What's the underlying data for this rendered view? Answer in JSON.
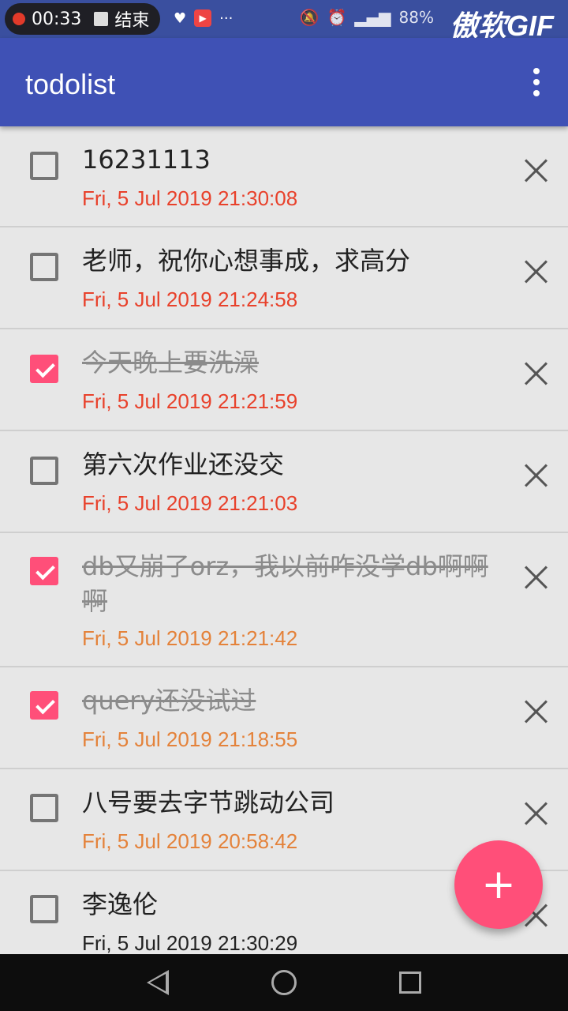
{
  "status": {
    "time": "00:33",
    "end_label": "结束",
    "battery": "88%",
    "watermark": "傲软GIF"
  },
  "appbar": {
    "title": "todolist"
  },
  "colors": {
    "appbar": "#3f51b5",
    "accent": "#ff4f79",
    "date_red": "#e8412b",
    "date_orange": "#e4823a",
    "date_black": "#222222"
  },
  "todos": [
    {
      "text": "16231113",
      "date": "Fri, 5 Jul 2019 21:30:08",
      "done": false,
      "date_color": "red"
    },
    {
      "text": "老师，祝你心想事成，求高分",
      "date": "Fri, 5 Jul 2019 21:24:58",
      "done": false,
      "date_color": "red"
    },
    {
      "text": "今天晚上要洗澡",
      "date": "Fri, 5 Jul 2019 21:21:59",
      "done": true,
      "date_color": "red"
    },
    {
      "text": "第六次作业还没交",
      "date": "Fri, 5 Jul 2019 21:21:03",
      "done": false,
      "date_color": "red"
    },
    {
      "text": "db又崩了orz，我以前咋没学db啊啊啊",
      "date": "Fri, 5 Jul 2019 21:21:42",
      "done": true,
      "date_color": "orange"
    },
    {
      "text": "query还没试过",
      "date": "Fri, 5 Jul 2019 21:18:55",
      "done": true,
      "date_color": "orange"
    },
    {
      "text": "八号要去字节跳动公司",
      "date": "Fri, 5 Jul 2019 20:58:42",
      "done": false,
      "date_color": "orange"
    },
    {
      "text": "李逸伦",
      "date": "Fri, 5 Jul 2019 21:30:29",
      "done": false,
      "date_color": "black"
    }
  ],
  "fab": {
    "label": "+"
  }
}
